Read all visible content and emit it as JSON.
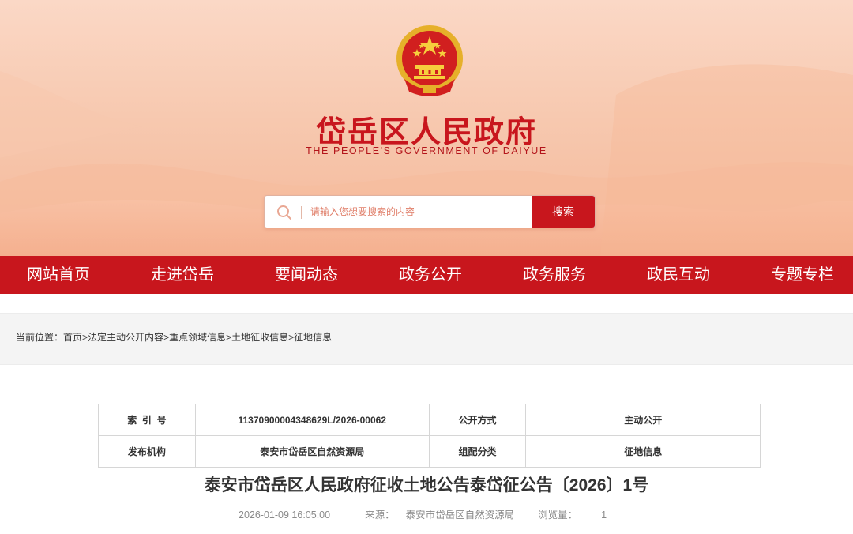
{
  "header": {
    "title": "岱岳区人民政府",
    "subtitle": "THE PEOPLE'S GOVERNMENT OF DAIYUE",
    "emblem_icon": "national-emblem"
  },
  "search": {
    "placeholder": "请输入您想要搜索的内容",
    "value": "",
    "button_label": "搜索"
  },
  "nav": {
    "items": [
      "网站首页",
      "走进岱岳",
      "要闻动态",
      "政务公开",
      "政务服务",
      "政民互动",
      "专题专栏"
    ]
  },
  "breadcrumb": {
    "label": "当前位置：",
    "items": [
      "首页",
      "法定主动公开内容",
      "重点领域信息",
      "土地征收信息",
      "征地信息"
    ],
    "separator": ">"
  },
  "info_table": {
    "rows": [
      [
        "索  引  号",
        "11370900004348629L/2026-00062",
        "公开方式",
        "主动公开"
      ],
      [
        "发布机构",
        "泰安市岱岳区自然资源局",
        "组配分类",
        "征地信息"
      ]
    ]
  },
  "article": {
    "title": "泰安市岱岳区人民政府征收土地公告泰岱征公告〔2026〕1号",
    "date": "2026-01-09 16:05:00",
    "source_label": "来源：",
    "source": "泰安市岱岳区自然资源局",
    "views_label": "浏览量：",
    "views": "1"
  },
  "colors": {
    "brand_red": "#c8161d",
    "banner_peach": "#f7c9b0",
    "crumb_bg": "#f4f4f4"
  }
}
